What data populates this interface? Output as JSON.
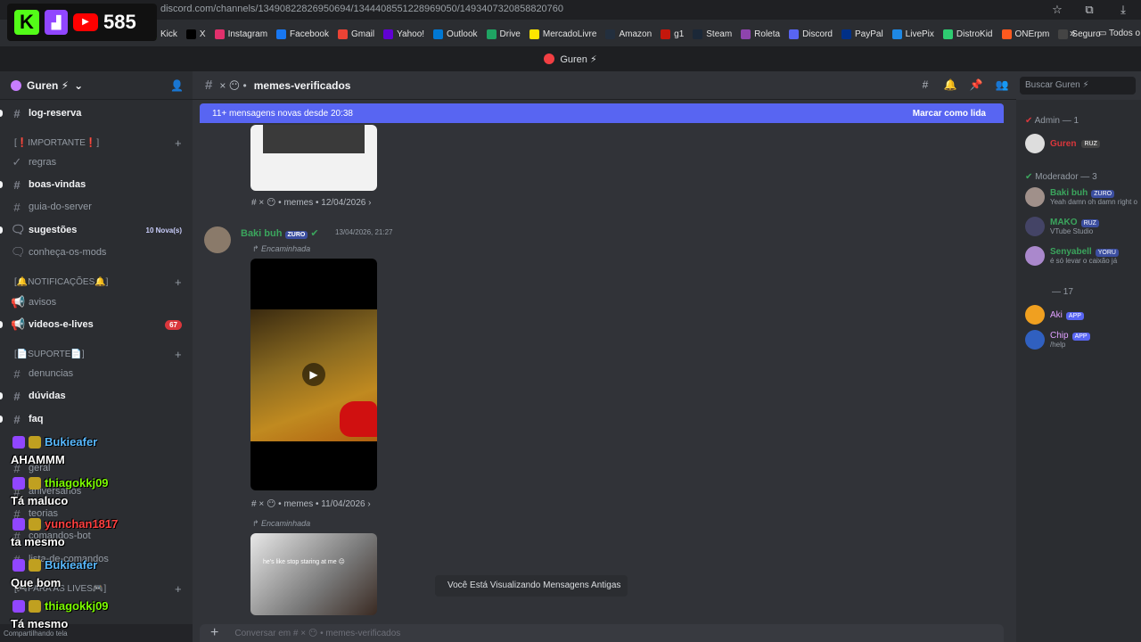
{
  "browser": {
    "url": "discord.com/channels/1349082282695069​4/1344408551228969050/1493407320858820760",
    "bookmarks": [
      "Kick",
      "X",
      "Instagram",
      "Facebook",
      "Gmail",
      "Yahoo!",
      "Outlook",
      "Drive",
      "MercadoLivre",
      "Amazon",
      "g1",
      "Steam",
      "Roleta",
      "Discord",
      "PayPal",
      "LivePix",
      "DistroKid",
      "ONErpm",
      "Seguro"
    ],
    "bookmark_more": "»",
    "all_bookmarks": "Todos o",
    "bookmark_colors": [
      "#53fc18",
      "#000000",
      "#e1306c",
      "#1877f2",
      "#ea4335",
      "#6001d2",
      "#0078d4",
      "#1fa463",
      "#ffe600",
      "#232f3e",
      "#c4170c",
      "#1b2838",
      "#8e44ad",
      "#5865f2",
      "#003087",
      "#1e88e5",
      "#2ecc71",
      "#ff5a1f",
      "#444444"
    ]
  },
  "stream_overlay": {
    "count": "585",
    "chat": [
      {
        "user": "Bukieafer",
        "color": "#58b9ff",
        "message": "AHAMMM"
      },
      {
        "user": "thiagokkj09",
        "color": "#7cfc00",
        "message": "Tá maluco"
      },
      {
        "user": "yunchan1817",
        "color": "#ff4040",
        "message": "ta mesmo"
      },
      {
        "user": "Bukieafer",
        "color": "#58b9ff",
        "message": "Que bom"
      },
      {
        "user": "thiagokkj09",
        "color": "#7cfc00",
        "message": "Tá mesmo"
      }
    ]
  },
  "window": {
    "title": "Guren ⚡"
  },
  "server": {
    "name": "Guren ⚡"
  },
  "sidebar": {
    "top_channel": "log-reserva",
    "categories": [
      "[❗IMPORTANTE❗]",
      "[🔔NOTIFICAÇÕES🔔]",
      "[📄SUPORTE📄]",
      "[🎮PARA AS LIVES🎮]"
    ],
    "channels": [
      {
        "name": "regras",
        "unread": false
      },
      {
        "name": "boas-vindas",
        "unread": true
      },
      {
        "name": "guia-do-server",
        "unread": false
      },
      {
        "name": "sugestões",
        "unread": true,
        "badge": "10 Nova(s)"
      },
      {
        "name": "conheça-os-mods",
        "unread": false
      },
      {
        "name": "avisos",
        "unread": false
      },
      {
        "name": "videos-e-lives",
        "unread": true,
        "badge": "67"
      },
      {
        "name": "denuncias",
        "unread": false
      },
      {
        "name": "dúvidas",
        "unread": true
      },
      {
        "name": "faq",
        "unread": true
      },
      {
        "name": "geral",
        "unread": false
      },
      {
        "name": "aniversarios",
        "unread": false
      },
      {
        "name": "teorias",
        "unread": false
      },
      {
        "name": "comandos-bot",
        "unread": false
      },
      {
        "name": "lista-de-comandos",
        "unread": false
      }
    ],
    "status_text": "Compartilhando tela"
  },
  "channel": {
    "name": "memes-verificados",
    "prefix": "× 😶 •"
  },
  "header": {
    "search_placeholder": "Buscar Guren ⚡"
  },
  "banner": {
    "text": "11+ mensagens novas desde 20:38",
    "action": "Marcar como lida"
  },
  "messages": {
    "meta1": "# × 😶 • memes • 12/04/2026 ›",
    "author": "Baki buh",
    "tag": "ZURO",
    "timestamp": "13/04/2026, 21:27",
    "forwarded": "Encaminhada",
    "meta2": "# × 😶 • memes • 11/04/2026 ›",
    "forwarded2": "Encaminhada",
    "caption": "he's like stop staring at me 😐"
  },
  "old_messages_notice": "Você Está Visualizando Mensagens Antigas",
  "composer": {
    "placeholder": "Conversar em # × 😶 • memes-verificados"
  },
  "members": {
    "admin_label": "Admin — 1",
    "admin": {
      "name": "Guren",
      "tag": "RUZ"
    },
    "mod_label": "Moderador — 3",
    "mods": [
      {
        "name": "Baki buh",
        "tag": "ZURO",
        "status": "Yeah damn oh damn right o",
        "color": "#3ba55d"
      },
      {
        "name": "MAKO",
        "tag": "RUZ",
        "status": "VTube Studio",
        "color": "#3ba55d"
      },
      {
        "name": "Senyabell",
        "tag": "YORU",
        "status": "é só levar o caixão já",
        "color": "#3ba55d"
      }
    ],
    "online_label": "— 17",
    "bots": [
      {
        "name": "Aki",
        "tag": "APP"
      },
      {
        "name": "Chip",
        "tag": "APP",
        "status": "/help"
      }
    ]
  }
}
